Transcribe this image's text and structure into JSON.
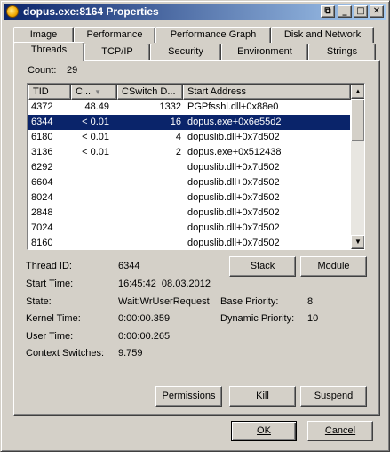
{
  "window": {
    "title": "dopus.exe:8164 Properties",
    "controls": [
      "⧉",
      "_",
      "□",
      "✕"
    ]
  },
  "tabs": {
    "row1": [
      "Image",
      "Performance",
      "Performance Graph",
      "Disk and Network"
    ],
    "row2": [
      "Threads",
      "TCP/IP",
      "Security",
      "Environment",
      "Strings"
    ],
    "active": "Threads"
  },
  "threads": {
    "count_label": "Count:",
    "count_value": "29",
    "columns": [
      "TID",
      "C...",
      "CSwitch D...",
      "Start Address"
    ],
    "rows": [
      {
        "tid": "4372",
        "cpu": "48.49",
        "cswitch": "1332",
        "address": "PGPfsshl.dll+0x88e0"
      },
      {
        "tid": "6344",
        "cpu": "< 0.01",
        "cswitch": "16",
        "address": "dopus.exe+0x6e55d2"
      },
      {
        "tid": "6180",
        "cpu": "< 0.01",
        "cswitch": "4",
        "address": "dopuslib.dll+0x7d502"
      },
      {
        "tid": "3136",
        "cpu": "< 0.01",
        "cswitch": "2",
        "address": "dopus.exe+0x512438"
      },
      {
        "tid": "6292",
        "cpu": "",
        "cswitch": "",
        "address": "dopuslib.dll+0x7d502"
      },
      {
        "tid": "6604",
        "cpu": "",
        "cswitch": "",
        "address": "dopuslib.dll+0x7d502"
      },
      {
        "tid": "8024",
        "cpu": "",
        "cswitch": "",
        "address": "dopuslib.dll+0x7d502"
      },
      {
        "tid": "2848",
        "cpu": "",
        "cswitch": "",
        "address": "dopuslib.dll+0x7d502"
      },
      {
        "tid": "7024",
        "cpu": "",
        "cswitch": "",
        "address": "dopuslib.dll+0x7d502"
      },
      {
        "tid": "8160",
        "cpu": "",
        "cswitch": "",
        "address": "dopuslib.dll+0x7d502"
      }
    ],
    "selected_tid": "6344"
  },
  "details": {
    "thread_id_label": "Thread ID:",
    "thread_id": "6344",
    "start_time_label": "Start Time:",
    "start_time": "16:45:42  08.03.2012",
    "state_label": "State:",
    "state": "Wait:WrUserRequest",
    "base_priority_label": "Base Priority:",
    "base_priority": "8",
    "kernel_time_label": "Kernel Time:",
    "kernel_time": "0:00:00.359",
    "dynamic_priority_label": "Dynamic Priority:",
    "dynamic_priority": "10",
    "user_time_label": "User Time:",
    "user_time": "0:00:00.265",
    "context_switches_label": "Context Switches:",
    "context_switches": "9.759"
  },
  "buttons": {
    "stack": "Stack",
    "module": "Module",
    "permissions": "Permissions",
    "kill": "Kill",
    "suspend": "Suspend",
    "ok": "OK",
    "cancel": "Cancel"
  }
}
